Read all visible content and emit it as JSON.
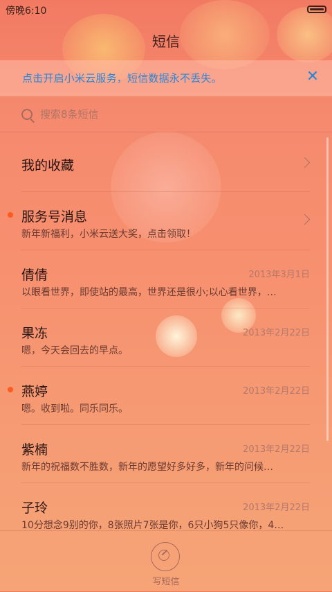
{
  "status": {
    "time": "傍晚6:10"
  },
  "header": {
    "title": "短信"
  },
  "banner": {
    "text": "点击开启小米云服务，短信数据永不丢失。",
    "close_icon": "close-icon"
  },
  "search": {
    "placeholder": "搜索8条短信",
    "icon": "search-icon"
  },
  "conversations": [
    {
      "name": "我的收藏",
      "date": "",
      "preview": "",
      "unread": false,
      "chevron": true
    },
    {
      "name": "服务号消息",
      "date": "",
      "preview": "新年新福利，小米云送大奖，点击领取！",
      "unread": true,
      "chevron": true
    },
    {
      "name": "倩倩",
      "date": "2013年3月1日",
      "preview": "以眼看世界，即使站的最高，世界还是很小;以心看世界，…",
      "unread": false,
      "chevron": false
    },
    {
      "name": "果冻",
      "date": "2013年2月22日",
      "preview": "嗯，今天会回去的早点。",
      "unread": false,
      "chevron": false
    },
    {
      "name": "燕婷",
      "date": "2013年2月22日",
      "preview": "嗯。收到啦。同乐同乐。",
      "unread": true,
      "chevron": false
    },
    {
      "name": "紫楠",
      "date": "2013年2月22日",
      "preview": "新年的祝福数不胜数，新年的愿望好多好多，新年的问候…",
      "unread": false,
      "chevron": false
    },
    {
      "name": "子玲",
      "date": "2013年2月22日",
      "preview": "10分想念9别的你，8张照片7张是你，6只小狗5只像你，4…",
      "unread": false,
      "chevron": false
    }
  ],
  "bottom": {
    "compose_label": "写短信"
  },
  "colors": {
    "accent": "#2a86d8",
    "unread_dot": "#ff5a1f",
    "background": "#f58a6e"
  }
}
